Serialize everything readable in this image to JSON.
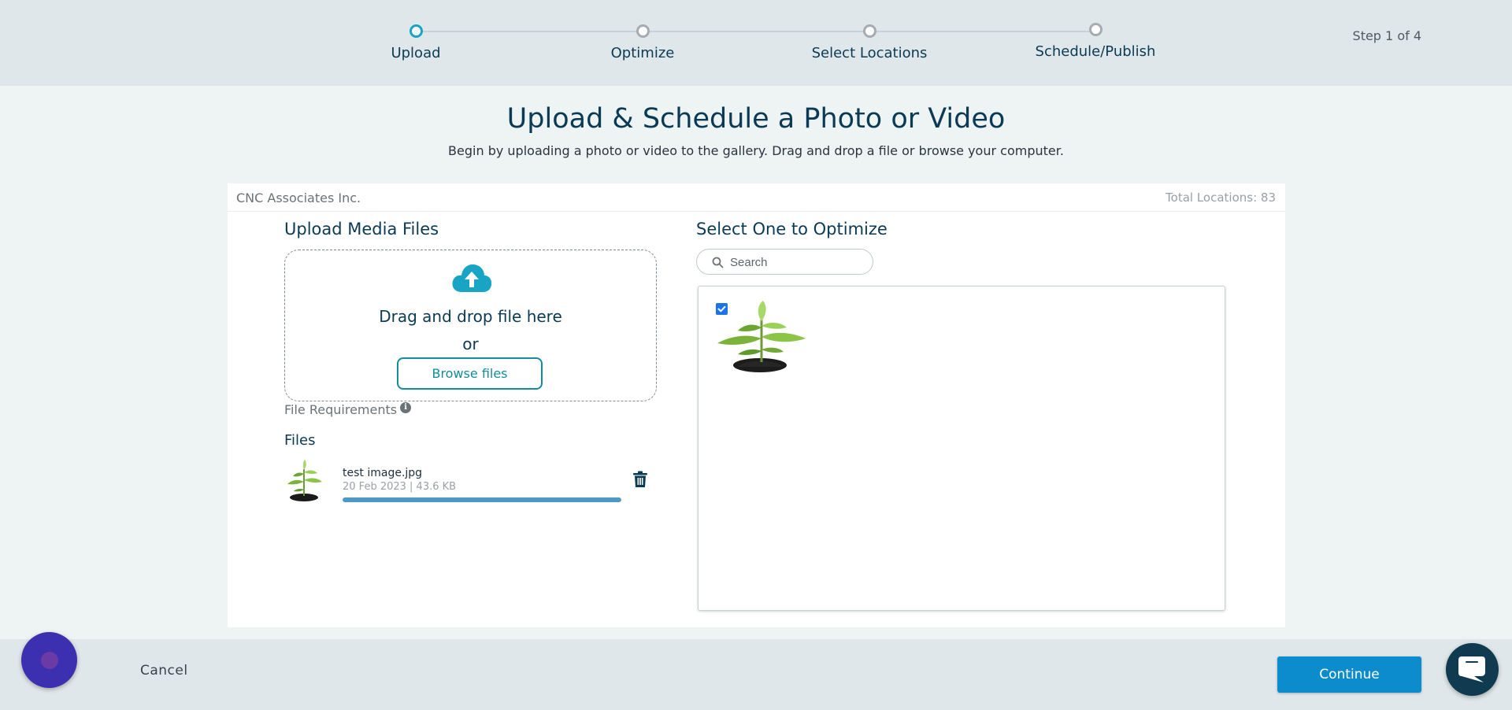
{
  "stepper": {
    "steps": [
      {
        "label": "Upload",
        "active": true
      },
      {
        "label": "Optimize",
        "active": false
      },
      {
        "label": "Select Locations",
        "active": false
      },
      {
        "label": "Schedule/Publish",
        "active": false
      }
    ],
    "counter": "Step 1 of 4"
  },
  "page": {
    "title": "Upload & Schedule a Photo or Video",
    "subtitle": "Begin by uploading a photo or video to the gallery. Drag and drop a file or browse your computer."
  },
  "card": {
    "org_name": "CNC Associates Inc.",
    "total_locations": "Total Locations: 83"
  },
  "upload": {
    "title": "Upload Media Files",
    "drop_text": "Drag and drop file here",
    "or_text": "or",
    "browse_label": "Browse files",
    "file_requirements": "File Requirements",
    "files_title": "Files",
    "files": [
      {
        "name": "test image.jpg",
        "meta": "20 Feb 2023 |  43.6 KB",
        "progress_percent": 100
      }
    ]
  },
  "optimize": {
    "title": "Select One to Optimize",
    "search_placeholder": "Search",
    "items": [
      {
        "selected": true,
        "icon": "plant-thumbnail"
      }
    ]
  },
  "footer": {
    "cancel_label": "Cancel",
    "continue_label": "Continue"
  },
  "colors": {
    "accent": "#17a4c5",
    "primary_button": "#0c8ccc",
    "heading": "#0b3a54",
    "browse_border": "#138c9e",
    "progress": "#4e98c6"
  }
}
